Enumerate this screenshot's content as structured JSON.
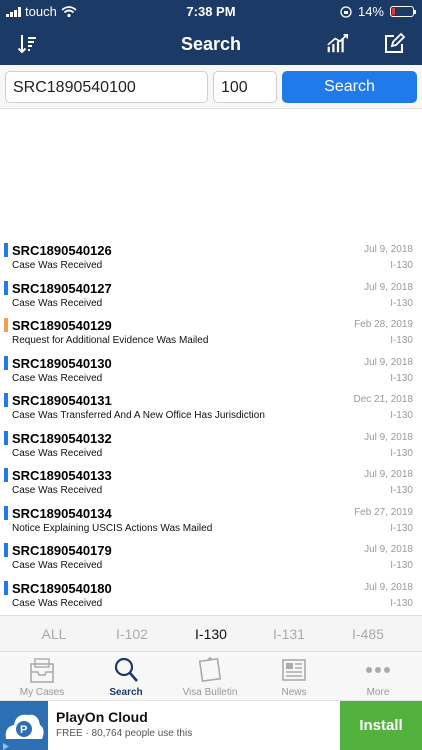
{
  "status_bar": {
    "carrier": "touch",
    "time": "7:38 PM",
    "battery": "14%",
    "battery_level": 0.14,
    "battery_color": "#e53935"
  },
  "nav": {
    "title": "Search"
  },
  "search": {
    "case_value": "SRC1890540100",
    "count_value": "100",
    "button_label": "Search"
  },
  "results": [
    {
      "case": "SRC1890540126",
      "status": "Case Was Received",
      "date": "Jul 9, 2018",
      "form": "I-130",
      "color": "#1f7bea"
    },
    {
      "case": "SRC1890540127",
      "status": "Case Was Received",
      "date": "Jul 9, 2018",
      "form": "I-130",
      "color": "#1f7bea"
    },
    {
      "case": "SRC1890540129",
      "status": "Request for Additional Evidence Was Mailed",
      "date": "Feb 28, 2019",
      "form": "I-130",
      "color": "#f0a04b"
    },
    {
      "case": "SRC1890540130",
      "status": "Case Was Received",
      "date": "Jul 9, 2018",
      "form": "I-130",
      "color": "#1f7bea"
    },
    {
      "case": "SRC1890540131",
      "status": "Case Was Transferred And A New Office Has Jurisdiction",
      "date": "Dec 21, 2018",
      "form": "I-130",
      "color": "#1f7bea"
    },
    {
      "case": "SRC1890540132",
      "status": "Case Was Received",
      "date": "Jul 9, 2018",
      "form": "I-130",
      "color": "#1f7bea"
    },
    {
      "case": "SRC1890540133",
      "status": "Case Was Received",
      "date": "Jul 9, 2018",
      "form": "I-130",
      "color": "#1f7bea"
    },
    {
      "case": "SRC1890540134",
      "status": "Notice Explaining USCIS Actions Was Mailed",
      "date": "Feb 27, 2019",
      "form": "I-130",
      "color": "#1f7bea"
    },
    {
      "case": "SRC1890540179",
      "status": "Case Was Received",
      "date": "Jul 9, 2018",
      "form": "I-130",
      "color": "#1f7bea"
    },
    {
      "case": "SRC1890540180",
      "status": "Case Was Received",
      "date": "Jul 9, 2018",
      "form": "I-130",
      "color": "#1f7bea"
    }
  ],
  "filters": {
    "all": "ALL",
    "i102": "I-102",
    "i130": "I-130",
    "i131": "I-131",
    "i485": "I-485"
  },
  "tabs": {
    "my_cases": "My Cases",
    "search": "Search",
    "visa_bulletin": "Visa Bulletin",
    "news": "News",
    "more": "More"
  },
  "ad": {
    "app_name": "PlayOn Cloud",
    "subtitle": "FREE · 80,764 people use this",
    "install_label": "Install"
  }
}
